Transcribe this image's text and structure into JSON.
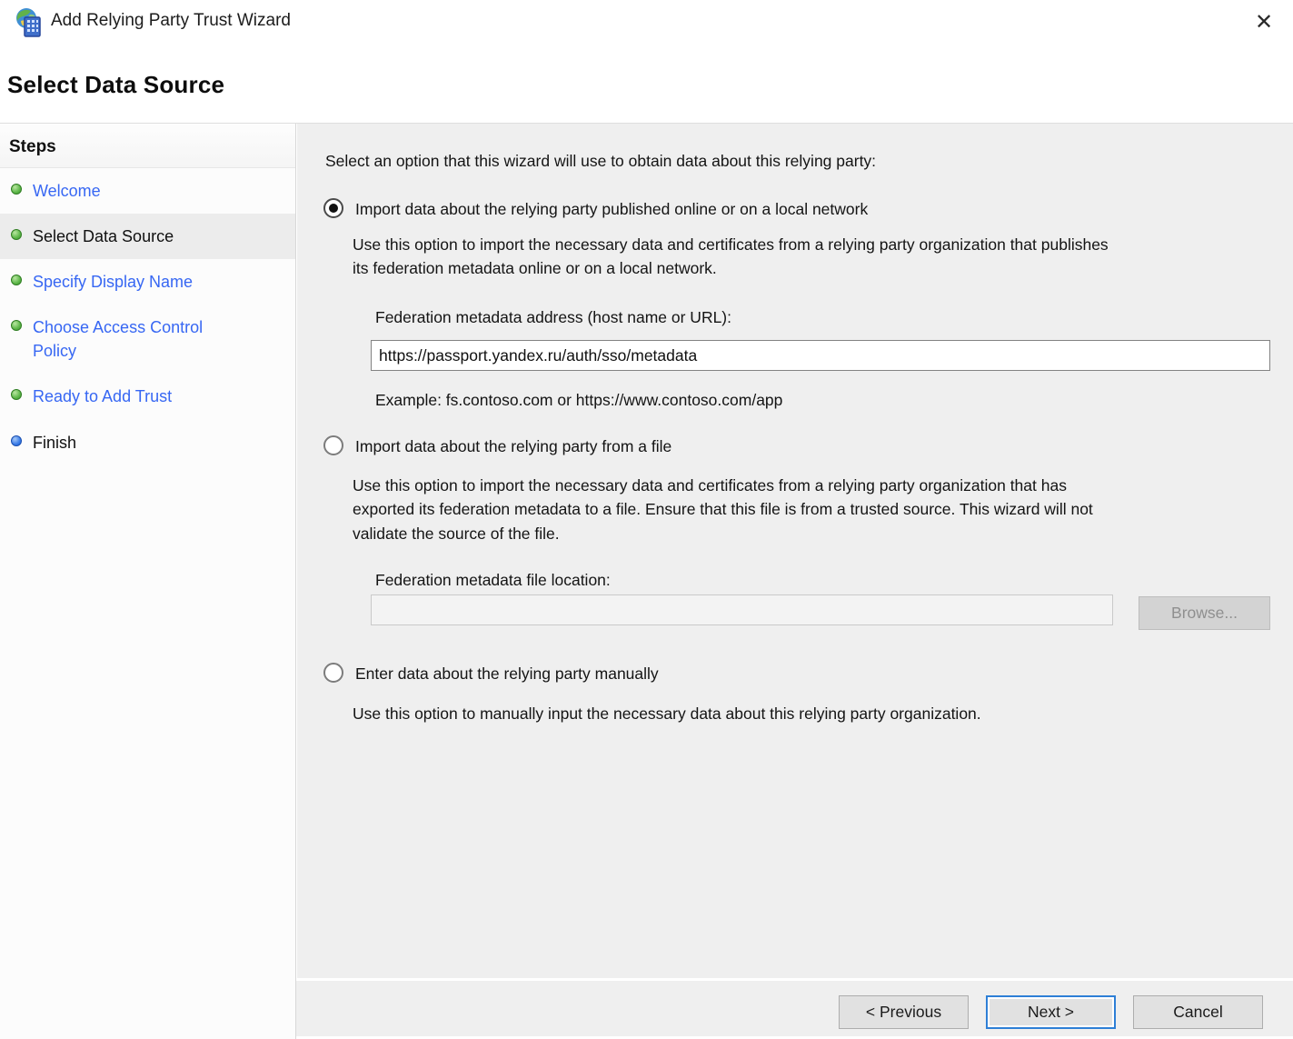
{
  "window": {
    "title": "Add Relying Party Trust Wizard",
    "close_glyph": "✕"
  },
  "page": {
    "heading": "Select Data Source"
  },
  "steps": {
    "header": "Steps",
    "items": [
      {
        "label": "Welcome",
        "state": "done",
        "current": false
      },
      {
        "label": "Select Data Source",
        "state": "done",
        "current": true
      },
      {
        "label": "Specify Display Name",
        "state": "done",
        "current": false
      },
      {
        "label": "Choose Access Control Policy",
        "state": "done",
        "current": false
      },
      {
        "label": "Ready to Add Trust",
        "state": "done",
        "current": false
      },
      {
        "label": "Finish",
        "state": "pending",
        "current": false
      }
    ]
  },
  "main": {
    "intro": "Select an option that this wizard will use to obtain data about this relying party:",
    "options": [
      {
        "label": "Import data about the relying party published online or on a local network",
        "selected": true,
        "description": "Use this option to import the necessary data and certificates from a relying party organization that publishes\nits federation metadata online or on a local network.",
        "field_label": "Federation metadata address (host name or URL):",
        "field_value": "https://passport.yandex.ru/auth/sso/metadata",
        "example": "Example: fs.contoso.com or https://www.contoso.com/app"
      },
      {
        "label": "Import data about the relying party from a file",
        "selected": false,
        "description": "Use this option to import the necessary data and certificates from a relying party organization that has\nexported its federation metadata to a file. Ensure that this file is from a trusted source.  This wizard will not\nvalidate the source of the file.",
        "field_label": "Federation metadata file location:",
        "field_value": "",
        "browse_label": "Browse..."
      },
      {
        "label": "Enter data about the relying party manually",
        "selected": false,
        "description": "Use this option to manually input the necessary data about this relying party organization."
      }
    ]
  },
  "footer": {
    "previous_label": "< Previous",
    "next_label": "Next >",
    "cancel_label": "Cancel"
  },
  "colors": {
    "link_blue": "#3767f3",
    "step_done_bullet": "#54b348",
    "step_pending_bullet": "#2f6fe0",
    "content_bg": "#efefef",
    "next_focus_border": "#2e7fd6"
  }
}
